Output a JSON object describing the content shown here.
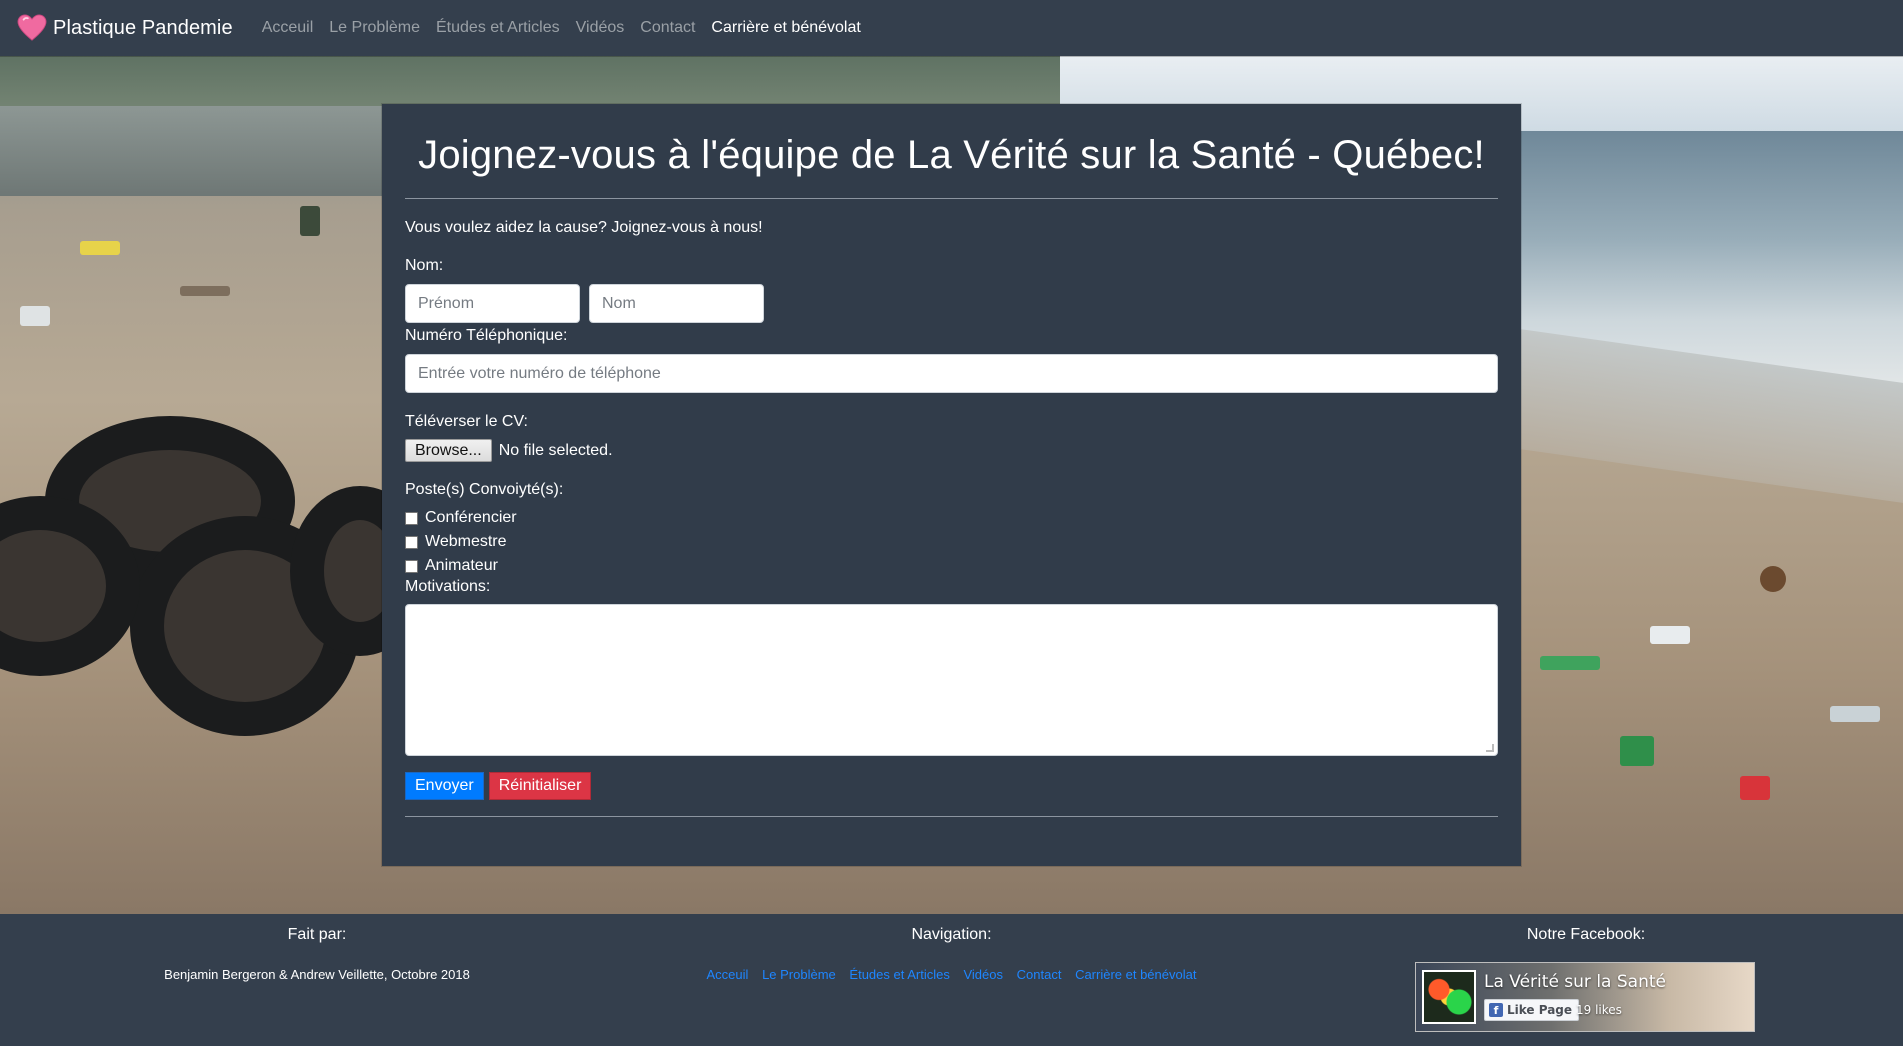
{
  "navbar": {
    "brand": "Plastique Pandemie",
    "links": [
      {
        "label": "Acceuil",
        "active": false
      },
      {
        "label": "Le Problème",
        "active": false
      },
      {
        "label": "Études et Articles",
        "active": false
      },
      {
        "label": "Vidéos",
        "active": false
      },
      {
        "label": "Contact",
        "active": false
      },
      {
        "label": "Carrière et bénévolat",
        "active": true
      }
    ]
  },
  "form": {
    "title": "Joignez-vous à l'équipe de La Vérité sur la Santé - Québec!",
    "intro": "Vous voulez aidez la cause? Joignez-vous à nous!",
    "name_label": "Nom:",
    "first_name_placeholder": "Prénom",
    "last_name_placeholder": "Nom",
    "first_name_value": "",
    "last_name_value": "",
    "phone_label": "Numéro Téléphonique:",
    "phone_placeholder": "Entrée votre numéro de téléphone",
    "phone_value": "",
    "cv_label": "Téléverser le CV:",
    "browse_label": "Browse...",
    "file_status": "No file selected.",
    "positions_label": "Poste(s) Convoiyté(s):",
    "positions": [
      {
        "label": "Conférencier",
        "checked": false
      },
      {
        "label": "Webmestre",
        "checked": false
      },
      {
        "label": "Animateur",
        "checked": false
      }
    ],
    "motivations_label": "Motivations:",
    "motivations_value": "",
    "submit_label": "Envoyer",
    "reset_label": "Réinitialiser"
  },
  "footer": {
    "credits_heading": "Fait par:",
    "credits_text": "Benjamin Bergeron & Andrew Veillette, Octobre 2018",
    "nav_heading": "Navigation:",
    "nav_links": [
      "Acceuil",
      "Le Problème",
      "Études et Articles",
      "Vidéos",
      "Contact",
      "Carrière et bénévolat"
    ],
    "facebook_heading": "Notre Facebook:",
    "facebook_page_name": "La Vérité sur la Santé",
    "facebook_like_label": "Like Page",
    "facebook_likes": "19 likes"
  },
  "colors": {
    "navbar_bg": "#343f4d",
    "card_bg": "#313c4a",
    "primary": "#007bff",
    "danger": "#dc3545",
    "link": "#1e86ff",
    "heart": "#f06aa0"
  },
  "icons": {
    "brand": "heart-icon",
    "facebook": "facebook-f-icon"
  }
}
